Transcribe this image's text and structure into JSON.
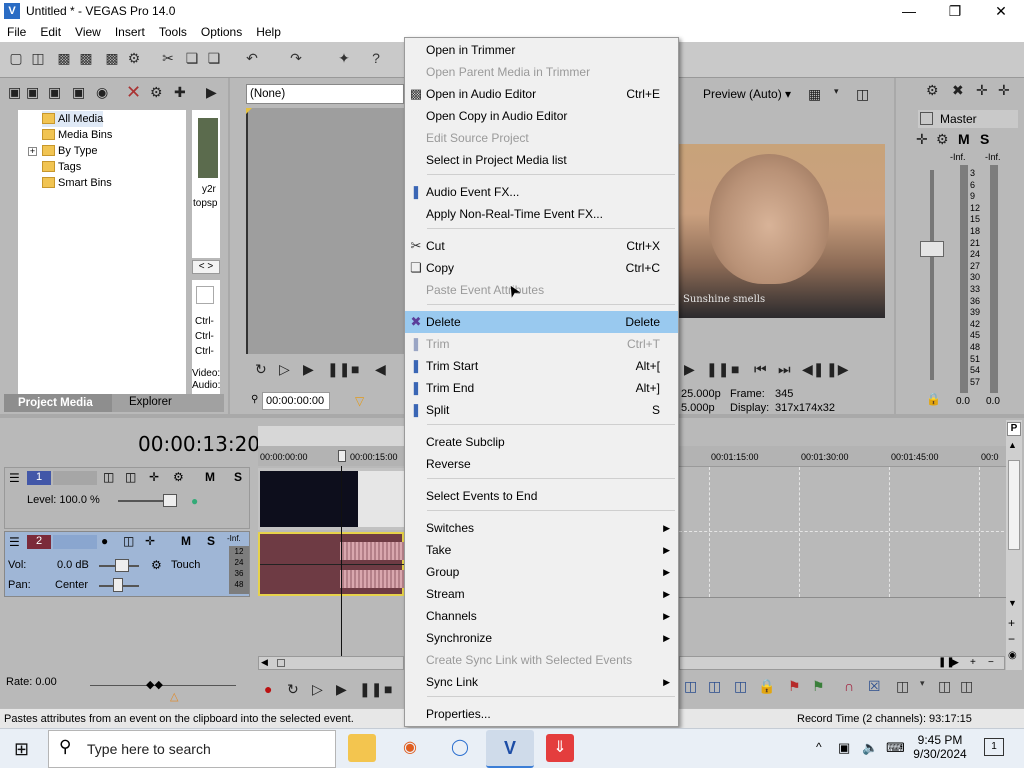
{
  "window": {
    "title": "Untitled * - VEGAS Pro 14.0",
    "minimize_icon": "minimize-icon",
    "maximize_icon": "maximize-icon",
    "close_icon": "close-icon"
  },
  "menu": [
    "File",
    "Edit",
    "View",
    "Insert",
    "Tools",
    "Options",
    "Help"
  ],
  "media_panel": {
    "tree": [
      "All Media",
      "Media Bins",
      "By Type",
      "Tags",
      "Smart Bins"
    ],
    "thumb_caption": [
      "y2r",
      "topsp"
    ],
    "side_labels": [
      "Ctrl-",
      "Ctrl-",
      "Ctrl-"
    ],
    "info_labels": [
      "Video:",
      "Audio:"
    ],
    "tabs": [
      "Project Media",
      "Explorer"
    ]
  },
  "trimmer": {
    "source": "(None)",
    "timecode": "00:00:00:00"
  },
  "preview": {
    "quality": "Preview (Auto)",
    "subtitle": "Sunshine smells",
    "frame_rate_1": "25.000p",
    "frame_rate_2": "5.000p",
    "frame_label": "Frame:",
    "frame_value": "345",
    "display_label": "Display:",
    "display_value": "317x174x32"
  },
  "master": {
    "label": "Master",
    "m": "M",
    "s": "S",
    "inf_left": "-Inf.",
    "inf_right": "-Inf.",
    "scale": [
      "3",
      "6",
      "9",
      "12",
      "15",
      "18",
      "21",
      "24",
      "27",
      "30",
      "33",
      "36",
      "39",
      "42",
      "45",
      "48",
      "51",
      "54",
      "57"
    ],
    "val_left": "0.0",
    "val_right": "0.0"
  },
  "timeline": {
    "timecode": "00:00:13:20",
    "ruler": [
      "00:00:00:00",
      "00:00:15:00",
      "00:01:15:00",
      "00:01:30:00",
      "00:01:45:00",
      "00:0"
    ],
    "track1": {
      "num": "1",
      "m": "M",
      "s": "S",
      "level": "Level: 100.0 %"
    },
    "track2": {
      "num": "2",
      "m": "M",
      "s": "S",
      "vol_label": "Vol:",
      "vol_value": "0.0 dB",
      "pan_label": "Pan:",
      "pan_value": "Center",
      "automation": "Touch",
      "meter_top": "-Inf.",
      "meter_scale": [
        "12",
        "24",
        "36",
        "48"
      ]
    },
    "rate": "Rate: 0.00"
  },
  "context_menu": {
    "items": [
      {
        "label": "Open in Trimmer",
        "shortcut": "",
        "disabled": false
      },
      {
        "label": "Open Parent Media in Trimmer",
        "shortcut": "",
        "disabled": true
      },
      {
        "label": "Open in Audio Editor",
        "shortcut": "Ctrl+E",
        "disabled": false
      },
      {
        "label": "Open Copy in Audio Editor",
        "shortcut": "",
        "disabled": false
      },
      {
        "label": "Edit Source Project",
        "shortcut": "",
        "disabled": true
      },
      {
        "label": "Select in Project Media list",
        "shortcut": "",
        "disabled": false
      },
      {
        "label": "Audio Event FX...",
        "shortcut": "",
        "disabled": false
      },
      {
        "label": "Apply Non-Real-Time Event FX...",
        "shortcut": "",
        "disabled": false
      },
      {
        "label": "Cut",
        "shortcut": "Ctrl+X",
        "disabled": false
      },
      {
        "label": "Copy",
        "shortcut": "Ctrl+C",
        "disabled": false
      },
      {
        "label": "Paste Event Attributes",
        "shortcut": "",
        "disabled": true
      },
      {
        "label": "Delete",
        "shortcut": "Delete",
        "disabled": false
      },
      {
        "label": "Trim",
        "shortcut": "Ctrl+T",
        "disabled": true
      },
      {
        "label": "Trim Start",
        "shortcut": "Alt+[",
        "disabled": false
      },
      {
        "label": "Trim End",
        "shortcut": "Alt+]",
        "disabled": false
      },
      {
        "label": "Split",
        "shortcut": "S",
        "disabled": false
      },
      {
        "label": "Create Subclip",
        "shortcut": "",
        "disabled": false
      },
      {
        "label": "Reverse",
        "shortcut": "",
        "disabled": false
      },
      {
        "label": "Select Events to End",
        "shortcut": "",
        "disabled": false
      },
      {
        "label": "Switches",
        "shortcut": "",
        "disabled": false
      },
      {
        "label": "Take",
        "shortcut": "",
        "disabled": false
      },
      {
        "label": "Group",
        "shortcut": "",
        "disabled": false
      },
      {
        "label": "Stream",
        "shortcut": "",
        "disabled": false
      },
      {
        "label": "Channels",
        "shortcut": "",
        "disabled": false
      },
      {
        "label": "Synchronize",
        "shortcut": "",
        "disabled": false
      },
      {
        "label": "Create Sync Link with Selected Events",
        "shortcut": "",
        "disabled": true
      },
      {
        "label": "Sync Link",
        "shortcut": "",
        "disabled": false
      },
      {
        "label": "Properties...",
        "shortcut": "",
        "disabled": false
      }
    ],
    "highlighted": "Delete"
  },
  "statusbar": {
    "left": "Pastes attributes from an event on the clipboard into the selected event.",
    "right": "Record Time (2 channels): 93:17:15"
  },
  "taskbar": {
    "search_placeholder": "Type here to search",
    "time": "9:45 PM",
    "date": "9/30/2024",
    "notification_count": "1"
  }
}
